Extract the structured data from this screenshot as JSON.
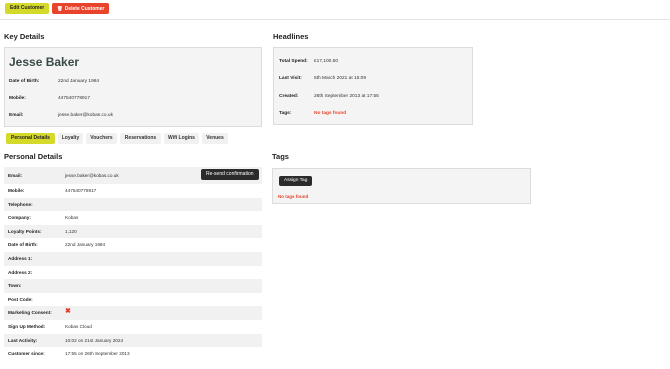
{
  "actions": {
    "edit_label": "Edit Customer",
    "delete_label": "Delete Customer"
  },
  "key_details": {
    "heading": "Key Details",
    "name": "Jesse Baker",
    "rows": [
      {
        "label": "Date of Birth:",
        "value": "22nd January 1984"
      },
      {
        "label": "Mobile:",
        "value": "447540778917"
      },
      {
        "label": "Email:",
        "value": "jesse.baker@kobas.co.uk"
      }
    ]
  },
  "headlines": {
    "heading": "Headlines",
    "rows": [
      {
        "label": "Total Spend:",
        "value": "£17,100.50"
      },
      {
        "label": "Last Visit:",
        "value": "5th March 2021 at 15:09"
      },
      {
        "label": "Created:",
        "value": "26th September 2013 at 17:55"
      },
      {
        "label": "Tags:",
        "value": "No tags found"
      }
    ]
  },
  "tabs": [
    {
      "label": "Personal Details",
      "active": true
    },
    {
      "label": "Loyalty",
      "active": false
    },
    {
      "label": "Vouchers",
      "active": false
    },
    {
      "label": "Reservations",
      "active": false
    },
    {
      "label": "Wifi Logins",
      "active": false
    },
    {
      "label": "Venues",
      "active": false
    }
  ],
  "personal_details": {
    "heading": "Personal Details",
    "resend_label": "Re-send confirmation",
    "marketing_consent_icon": "cross-icon",
    "rows": [
      {
        "label": "Email:",
        "value": "jesse.baker@kobas.co.uk"
      },
      {
        "label": "Mobile:",
        "value": "447540778917"
      },
      {
        "label": "Telephone:",
        "value": ""
      },
      {
        "label": "Company:",
        "value": "Kobas"
      },
      {
        "label": "Loyalty Points:",
        "value": "1,120"
      },
      {
        "label": "Date of Birth:",
        "value": "22nd January 1984"
      },
      {
        "label": "Address 1:",
        "value": ""
      },
      {
        "label": "Address 2:",
        "value": ""
      },
      {
        "label": "Town:",
        "value": ""
      },
      {
        "label": "Post Code:",
        "value": ""
      },
      {
        "label": "Marketing Consent:",
        "value": "✖"
      },
      {
        "label": "Sign Up Method:",
        "value": "Kobas Cloud"
      },
      {
        "label": "Last Activity:",
        "value": "10:02 on 21st January 2024"
      },
      {
        "label": "Customer since:",
        "value": "17:55 on 26th September 2013"
      }
    ]
  },
  "tags": {
    "heading": "Tags",
    "assign_label": "Assign Tag",
    "empty_text": "No tags found"
  },
  "colors": {
    "accent": "#d4d92a",
    "danger": "#e8442c",
    "dark_button": "#2b2b2b"
  }
}
